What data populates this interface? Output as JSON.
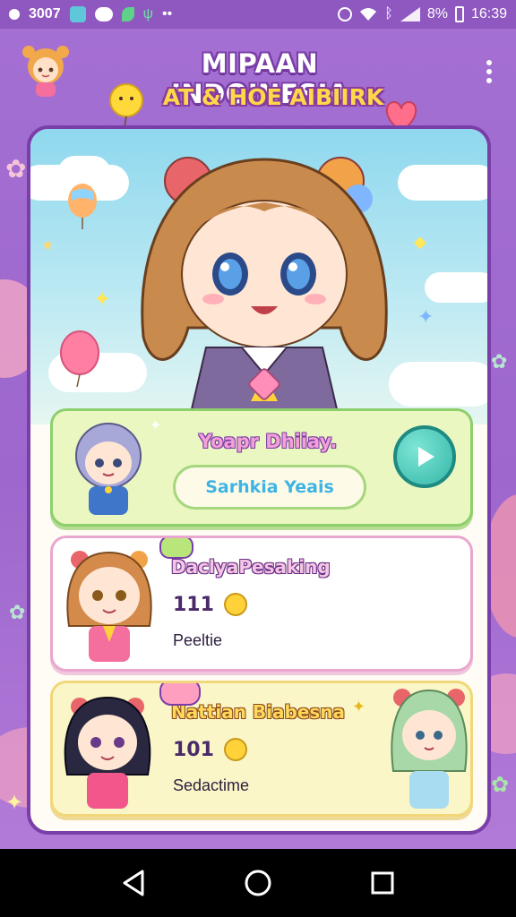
{
  "status_bar": {
    "left_text": "3007",
    "battery": "8%",
    "time": "16:39"
  },
  "header": {
    "title_line1": "MIPAAN INDOINESIA",
    "title_line2": "AT & HOE AIBIIRK"
  },
  "featured": {
    "title": "Yoapr Dhiiay.",
    "button_label": "Sarhkia Yeais"
  },
  "items": [
    {
      "name": "DaclyaPesaking",
      "count": "111",
      "subtitle": "Peeltie"
    },
    {
      "name": "Nattian Biabesna",
      "count": "101",
      "subtitle": "Sedactime"
    }
  ],
  "colors": {
    "background": "#9a62c8",
    "card_border": "#7a3ea8",
    "featured_bg": "#eaf7c0",
    "play_button": "#33b6a8"
  },
  "icons": {
    "menu": "more-vert-icon",
    "play": "play-icon",
    "coin": "coin-icon",
    "back": "nav-back-icon",
    "home": "nav-home-icon",
    "recents": "nav-recents-icon"
  }
}
